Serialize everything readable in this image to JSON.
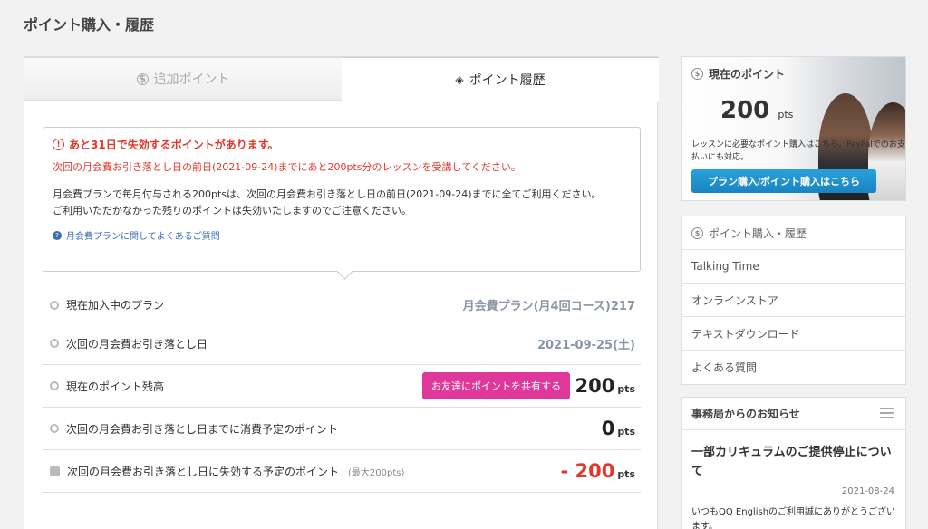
{
  "page": {
    "title": "ポイント購入・履歴"
  },
  "tabs": {
    "add_points": "追加ポイント",
    "point_history": "ポイント履歴"
  },
  "notice": {
    "title": "あと31日で失効するポイントがあります。",
    "warning_line": "次回の月会費お引き落とし日の前日(2021-09-24)までにあと200pts分のレッスンを受講してください。",
    "body_line1": "月会費プランで毎月付与される200ptsは、次回の月会費お引き落とし日の前日(2021-09-24)までに全てご利用ください。",
    "body_line2": "ご利用いただかなかった残りのポイントは失効いたしますのでご注意ください。",
    "faq_link": "月会費プランに関してよくあるご質問"
  },
  "rows": {
    "plan_label": "現在加入中のプラン",
    "plan_value": "月会費プラン(月4回コース)217",
    "next_charge_label": "次回の月会費お引き落とし日",
    "next_charge_value": "2021-09-25(土)",
    "balance_label": "現在のポイント残高",
    "share_button": "お友達にポイントを共有する",
    "balance_value": "200",
    "consume_label": "次回の月会費お引き落とし日までに消費予定のポイント",
    "consume_value": "0",
    "expire_label": "次回の月会費お引き落とし日に失効する予定のポイント",
    "expire_note": "(最大200pts)",
    "expire_value": "- 200",
    "unit": "pts"
  },
  "points_box": {
    "title": "現在のポイント",
    "value": "200",
    "unit": "pts",
    "desc": "レッスンに必要なポイント購入はこちら。PayPalでのお支払いにも対応。",
    "button": "プラン購入/ポイント購入はこちら"
  },
  "menu": {
    "items": [
      "ポイント購入・履歴",
      "Talking Time",
      "オンラインストア",
      "テキストダウンロード",
      "よくある質問"
    ]
  },
  "news": {
    "title": "事務局からのお知らせ",
    "item_title": "一部カリキュラムのご提供停止について",
    "item_date": "2021-08-24",
    "item_body": "いつもQQ Englishのご利用誠にありがとうございます。"
  },
  "colors": {
    "accent_red": "#e0382b",
    "share_pink": "#e0389a",
    "plan_blue": "#1a83c2"
  }
}
